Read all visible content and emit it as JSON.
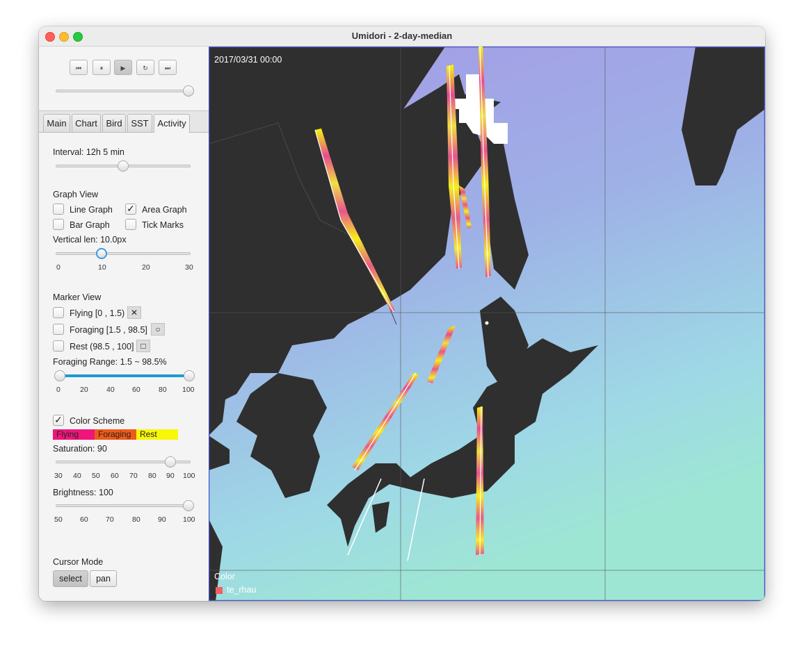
{
  "window": {
    "title": "Umidori - 2-day-median"
  },
  "playback": {
    "buttons": [
      {
        "name": "skip-start",
        "glyph": "⏮"
      },
      {
        "name": "pause",
        "glyph": "⏸"
      },
      {
        "name": "play",
        "glyph": "▶"
      },
      {
        "name": "reload",
        "glyph": "↻"
      },
      {
        "name": "skip-end",
        "glyph": "⏭"
      }
    ],
    "position": 1.0
  },
  "tabs": [
    {
      "label": "Main"
    },
    {
      "label": "Chart"
    },
    {
      "label": "Bird"
    },
    {
      "label": "SST"
    },
    {
      "label": "Activity",
      "selected": true
    }
  ],
  "activity": {
    "interval_label": "Interval: 12h 5 min",
    "interval_position": 0.5,
    "graph_view": {
      "heading": "Graph View",
      "line_graph": {
        "label": "Line Graph",
        "checked": false
      },
      "area_graph": {
        "label": "Area Graph",
        "checked": true
      },
      "bar_graph": {
        "label": "Bar Graph",
        "checked": false
      },
      "tick_marks": {
        "label": "Tick Marks",
        "checked": false
      }
    },
    "vertical_len": {
      "label": "Vertical len: 10.0px",
      "value": 10,
      "min": 0,
      "max": 30,
      "ticks": [
        "0",
        "10",
        "20",
        "30"
      ]
    },
    "marker_view": {
      "heading": "Marker View",
      "flying": {
        "label": "Flying  [0 , 1.5)",
        "marker_glyph": "✕",
        "checked": false
      },
      "foraging": {
        "label": "Foraging  [1.5 , 98.5]",
        "marker_glyph": "○",
        "checked": false
      },
      "rest": {
        "label": "Rest  (98.5 , 100]",
        "marker_glyph": "□",
        "checked": false
      }
    },
    "foraging_range": {
      "label": "Foraging Range: 1.5 ~ 98.5%",
      "low": 1.5,
      "high": 98.5,
      "ticks": [
        "0",
        "20",
        "40",
        "60",
        "80",
        "100"
      ]
    },
    "color_scheme": {
      "label": "Color Scheme",
      "checked": true,
      "swatches": [
        {
          "label": "Flying",
          "color": "#f0157a"
        },
        {
          "label": "Foraging",
          "color": "#f05a19"
        },
        {
          "label": "Rest",
          "color": "#f7f707"
        }
      ]
    },
    "saturation": {
      "label": "Saturation: 90",
      "value": 90,
      "min": 30,
      "max": 100,
      "ticks": [
        "30",
        "40",
        "50",
        "60",
        "70",
        "80",
        "90",
        "100"
      ]
    },
    "brightness": {
      "label": "Brightness: 100",
      "value": 100,
      "min": 50,
      "max": 100,
      "ticks": [
        "50",
        "60",
        "70",
        "80",
        "90",
        "100"
      ]
    },
    "cursor_mode": {
      "label": "Cursor Mode",
      "select_label": "select",
      "pan_label": "pan",
      "active": "select"
    }
  },
  "map": {
    "timestamp": "2017/03/31 00:00",
    "legend_title": "Color",
    "legend_item": {
      "label": "te_rhau",
      "color": "#f06060"
    }
  }
}
